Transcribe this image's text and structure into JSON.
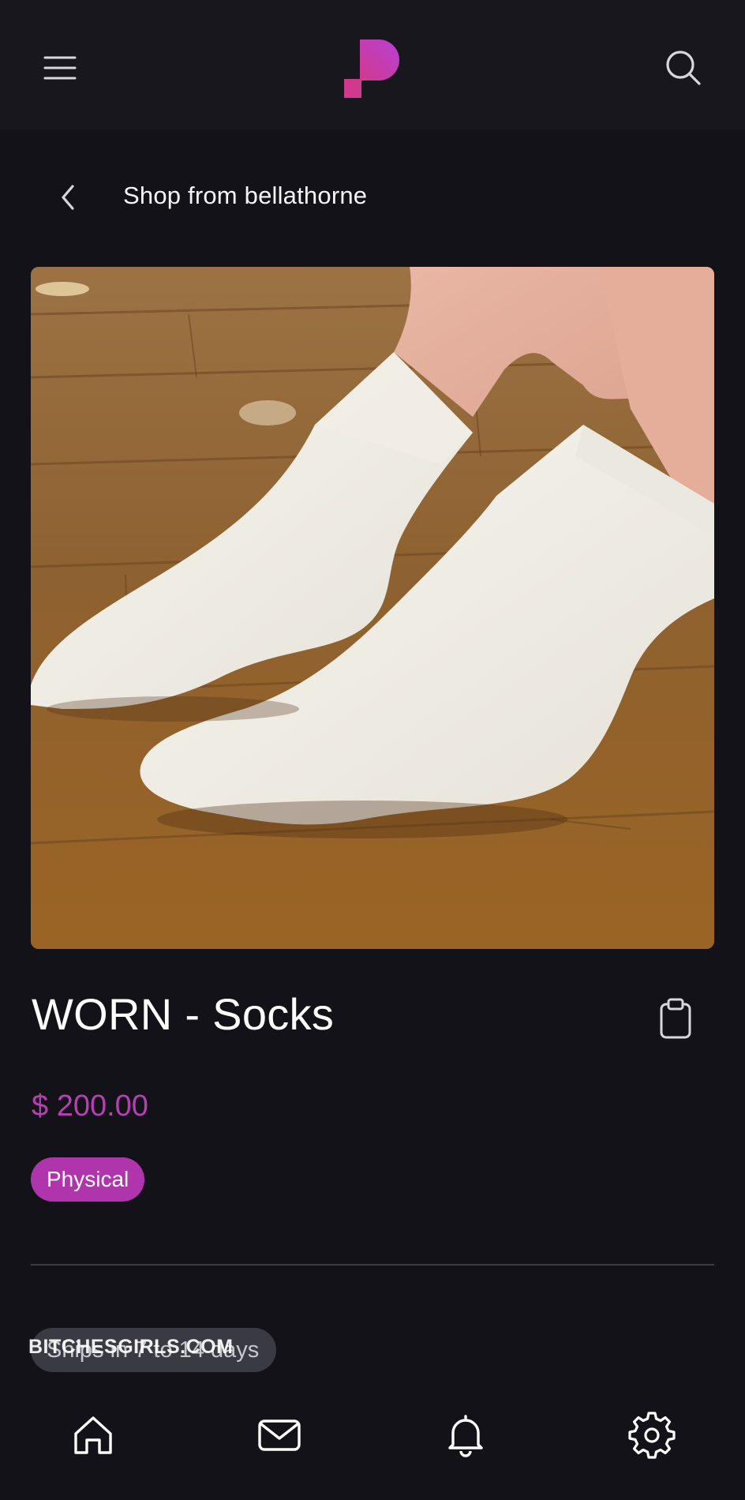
{
  "header": {
    "back_icon": "chevron-left-icon",
    "title": "Shop from bellathorne"
  },
  "topbar": {
    "menu_icon": "menu-icon",
    "logo": "brand-logo",
    "search_icon": "search-icon",
    "brand_colors": [
      "#b83fd6",
      "#d13a8c"
    ]
  },
  "product": {
    "title": "WORN - Socks",
    "price": "$ 200.00",
    "badge": "Physical",
    "shipping": "Ships in 7 to 14 days",
    "price_color": "#b63fb3",
    "badge_color": "#b035ad"
  },
  "watermark": "BITCHESGIRLS.COM",
  "bottom_nav": [
    {
      "name": "home",
      "icon": "home-icon"
    },
    {
      "name": "messages",
      "icon": "mail-icon"
    },
    {
      "name": "notifications",
      "icon": "bell-icon"
    },
    {
      "name": "settings",
      "icon": "gear-icon"
    }
  ]
}
